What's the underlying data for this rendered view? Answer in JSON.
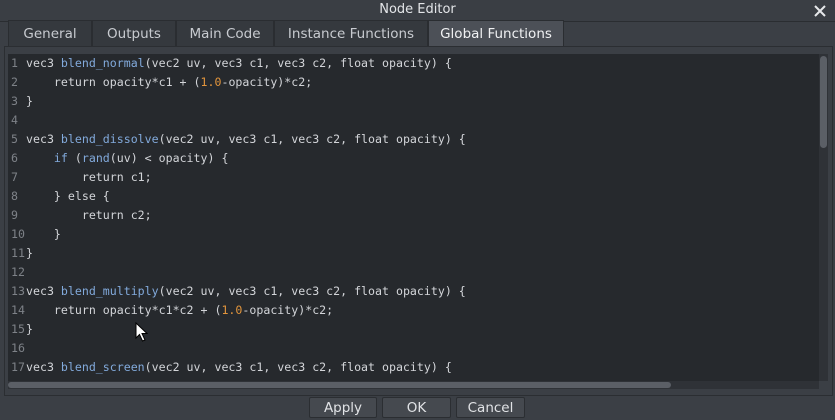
{
  "window": {
    "title": "Node Editor",
    "close_icon": "close-icon"
  },
  "tabs": [
    {
      "label": "General",
      "active": false
    },
    {
      "label": "Outputs",
      "active": false
    },
    {
      "label": "Main Code",
      "active": false
    },
    {
      "label": "Instance Functions",
      "active": false
    },
    {
      "label": "Global Functions",
      "active": true
    }
  ],
  "code_lines": [
    {
      "n": "1",
      "text": "vec3 blend_normal(vec2 uv, vec3 c1, vec3 c2, float opacity) {"
    },
    {
      "n": "2",
      "text": "    return opacity*c1 + (1.0-opacity)*c2;"
    },
    {
      "n": "3",
      "text": "}"
    },
    {
      "n": "4",
      "text": ""
    },
    {
      "n": "5",
      "text": "vec3 blend_dissolve(vec2 uv, vec3 c1, vec3 c2, float opacity) {"
    },
    {
      "n": "6",
      "text": "    if (rand(uv) < opacity) {"
    },
    {
      "n": "7",
      "text": "        return c1;"
    },
    {
      "n": "8",
      "text": "    } else {"
    },
    {
      "n": "9",
      "text": "        return c2;"
    },
    {
      "n": "10",
      "text": "    }"
    },
    {
      "n": "11",
      "text": "}"
    },
    {
      "n": "12",
      "text": ""
    },
    {
      "n": "13",
      "text": "vec3 blend_multiply(vec2 uv, vec3 c1, vec3 c2, float opacity) {"
    },
    {
      "n": "14",
      "text": "    return opacity*c1*c2 + (1.0-opacity)*c2;"
    },
    {
      "n": "15",
      "text": "}"
    },
    {
      "n": "16",
      "text": ""
    },
    {
      "n": "17",
      "text": "vec3 blend_screen(vec2 uv, vec3 c1, vec3 c2, float opacity) {"
    }
  ],
  "buttons": {
    "apply": "Apply",
    "ok": "OK",
    "cancel": "Cancel"
  },
  "colors": {
    "function_name": "#82aadc",
    "keyword": "#82aadc",
    "number": "#e2953c",
    "editor_background": "#26292d"
  }
}
